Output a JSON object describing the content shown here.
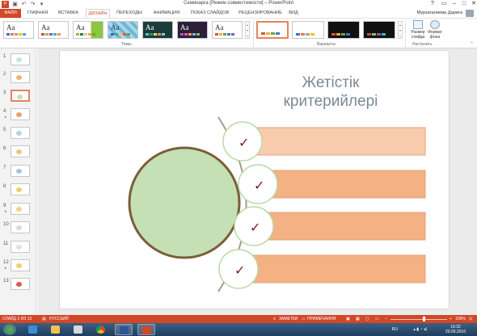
{
  "window": {
    "title": "Семинарға [Режим совместимости] – PowerPoint",
    "user": "Мурзагалиева Дарига"
  },
  "tabs": [
    "ФАЙЛ",
    "ГЛАВНАЯ",
    "ВСТАВКА",
    "ДИЗАЙН",
    "ПЕРЕХОДЫ",
    "АНИМАЦИЯ",
    "ПОКАЗ СЛАЙДОВ",
    "РЕЦЕНЗИРОВАНИЕ",
    "ВИД"
  ],
  "active_tab": "ДИЗАЙН",
  "ribbon": {
    "themes_label": "Темы",
    "variants_label": "Варианты",
    "customize_label": "Настроить",
    "theme_sample": "Aa",
    "slide_size_label": "Размер слайда",
    "format_bg_label": "Формат фона"
  },
  "thumbnails": [
    "1",
    "2",
    "3",
    "4",
    "5",
    "6",
    "7",
    "8",
    "9",
    "10",
    "11",
    "12",
    "13"
  ],
  "selected_slide": 3,
  "slide": {
    "title_line1": "Жетістік",
    "title_line2": "критерийлері",
    "checkmark": "✓",
    "colors": {
      "circle_fill": "#c5e0b4",
      "circle_border": "#7b5e3b",
      "bar_fill": "#f4b183",
      "bar_fill_light": "#f8cbad",
      "check": "#7b1a24"
    }
  },
  "status": {
    "slide_info": "СЛАЙД 3 ИЗ 13",
    "language": "РУССКИЙ",
    "notes": "ЗАМЕТКИ",
    "comments": "ПРИМЕЧАНИЯ",
    "zoom": "109%"
  },
  "taskbar": {
    "lang": "RU",
    "time": "16:32",
    "date": "20.09.2016"
  }
}
